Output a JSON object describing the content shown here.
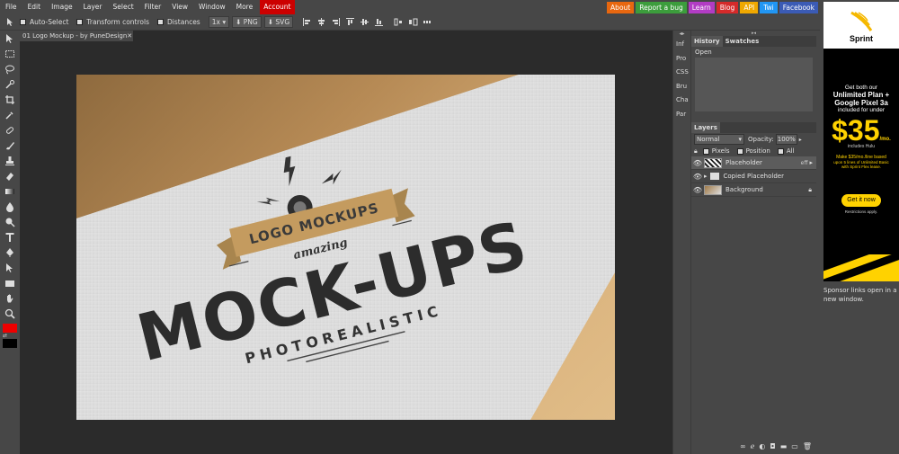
{
  "menu": {
    "items": [
      "File",
      "Edit",
      "Image",
      "Layer",
      "Select",
      "Filter",
      "View",
      "Window",
      "More"
    ],
    "account": "Account",
    "links": [
      {
        "label": "About",
        "color": "#e8670f"
      },
      {
        "label": "Report a bug",
        "color": "#3c9d3c"
      },
      {
        "label": "Learn",
        "color": "#b23cc4"
      },
      {
        "label": "Blog",
        "color": "#d52a2a"
      },
      {
        "label": "API",
        "color": "#f0a800"
      },
      {
        "label": "Twi",
        "color": "#2196f3"
      },
      {
        "label": "Facebook",
        "color": "#3b5bb5"
      }
    ]
  },
  "options": {
    "auto_select": "Auto-Select",
    "transform_controls": "Transform controls",
    "distances": "Distances",
    "scale": "1x",
    "png": "PNG",
    "svg": "SVG"
  },
  "document": {
    "tab_title": "01 Logo Mockup - by PuneDesign",
    "close": "✕"
  },
  "artwork": {
    "ribbon": "LOGO MOCKUPS",
    "script": "amazing",
    "headline": "MOCK-UPS",
    "tagline": "PHOTOREALISTIC"
  },
  "mini_panel": [
    "Inf",
    "Pro",
    "CSS",
    "Bru",
    "Cha",
    "Par"
  ],
  "history": {
    "tabs": [
      "History",
      "Swatches"
    ],
    "items": [
      "Open"
    ]
  },
  "layers": {
    "tab": "Layers",
    "blend_mode": "Normal",
    "opacity_label": "Opacity:",
    "opacity_value": "100%",
    "lock_pixels": "Pixels",
    "lock_position": "Position",
    "lock_all": "All",
    "rows": [
      {
        "name": "Placeholder",
        "badge": "eff"
      },
      {
        "name": "Copied Placeholder",
        "badge": ""
      },
      {
        "name": "Background",
        "badge": ""
      }
    ]
  },
  "ad": {
    "brand": "Sprint",
    "line1": "Get both our",
    "line2": "Unlimited Plan +",
    "line3": "Google Pixel 3a",
    "line4": "included for under",
    "price": "$35",
    "price_suffix": "/mo.",
    "includes": "includes Hulu",
    "fine1": "Make $35/mo./line based",
    "fine2": "upon 5 lines of Unlimited Basic",
    "fine3": "with Sprint Flex lease.",
    "cta": "Get it now",
    "restrictions": "Restrictions apply.",
    "note": "Sponsor links open in a new window."
  },
  "colors": {
    "foreground": "#e00000",
    "background": "#000000",
    "accent_account": "#cc0000",
    "ad_yellow": "#ffd200"
  }
}
